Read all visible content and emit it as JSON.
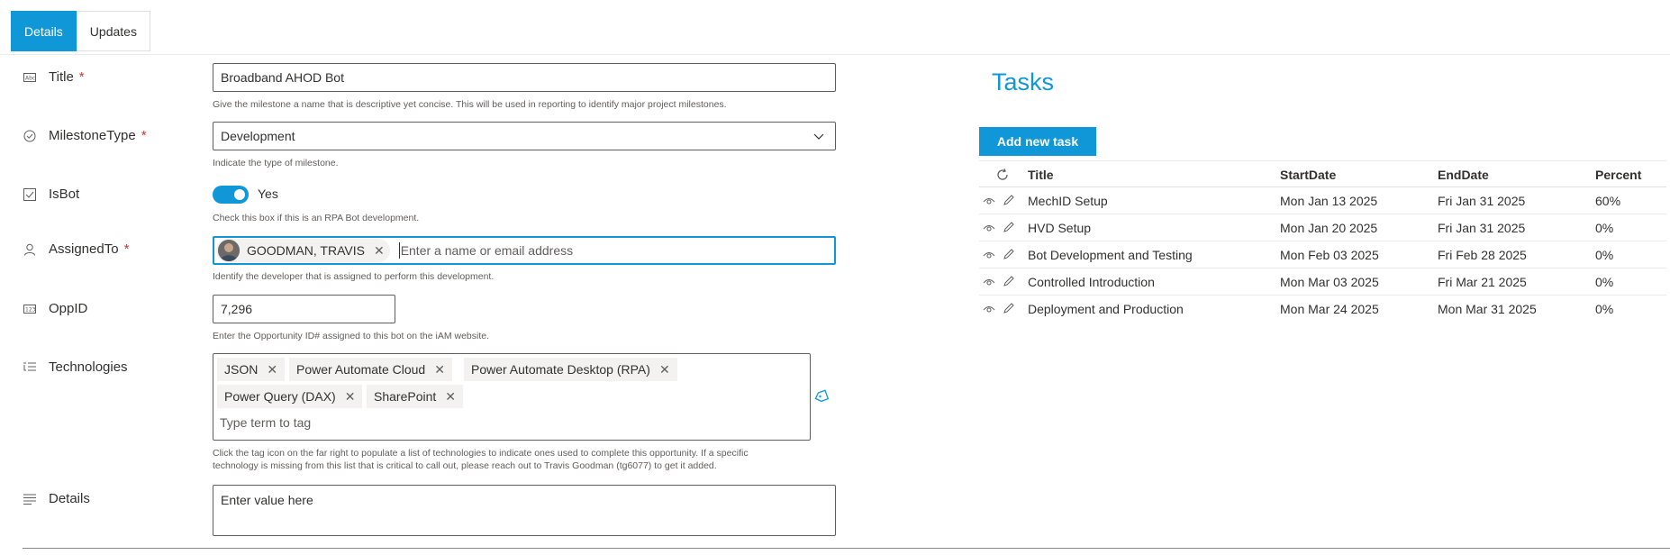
{
  "tabs": [
    {
      "label": "Details",
      "active": true
    },
    {
      "label": "Updates",
      "active": false
    }
  ],
  "form": {
    "title": {
      "label": "Title",
      "required": "*",
      "value": "Broadband AHOD Bot",
      "help": "Give the milestone a name that is descriptive yet concise. This will be used in reporting to identify major project milestones."
    },
    "milestone_type": {
      "label": "MilestoneType",
      "required": "*",
      "value": "Development",
      "help": "Indicate the type of milestone."
    },
    "is_bot": {
      "label": "IsBot",
      "value": "Yes",
      "checked": true,
      "help": "Check this box if this is an RPA Bot development."
    },
    "assigned_to": {
      "label": "AssignedTo",
      "required": "*",
      "person": "GOODMAN, TRAVIS",
      "placeholder": "Enter a name or email address",
      "help": "Identify the developer that is assigned to perform this development."
    },
    "opp_id": {
      "label": "OppID",
      "value": "7,296",
      "help": "Enter the Opportunity ID# assigned to this bot on the iAM website."
    },
    "technologies": {
      "label": "Technologies",
      "tags": [
        "JSON",
        "Power Automate Cloud",
        "Power Automate Desktop (RPA)",
        "Power Query (DAX)",
        "SharePoint"
      ],
      "placeholder": "Type term to tag",
      "help_line1": "Click the tag icon on the far right to populate a list of technologies to indicate ones used to complete this opportunity. If a specific",
      "help_line2": "technology is missing from this list that is critical to call out, please reach out to Travis Goodman (tg6077) to get it added."
    },
    "details": {
      "label": "Details",
      "placeholder": "Enter value here"
    }
  },
  "tasks": {
    "title": "Tasks",
    "add_button": "Add new task",
    "columns": [
      "Title",
      "StartDate",
      "EndDate",
      "Percent"
    ],
    "rows": [
      {
        "title": "MechID Setup",
        "start": "Mon Jan 13 2025",
        "end": "Fri Jan 31 2025",
        "percent": "60%"
      },
      {
        "title": "HVD Setup",
        "start": "Mon Jan 20 2025",
        "end": "Fri Jan 31 2025",
        "percent": "0%"
      },
      {
        "title": "Bot Development and Testing",
        "start": "Mon Feb 03 2025",
        "end": "Fri Feb 28 2025",
        "percent": "0%"
      },
      {
        "title": "Controlled Introduction",
        "start": "Mon Mar 03 2025",
        "end": "Fri Mar 21 2025",
        "percent": "0%"
      },
      {
        "title": "Deployment and Production",
        "start": "Mon Mar 24 2025",
        "end": "Mon Mar 31 2025",
        "percent": "0%"
      }
    ]
  },
  "colors": {
    "accent": "#0f97d8",
    "required": "#d13438"
  }
}
